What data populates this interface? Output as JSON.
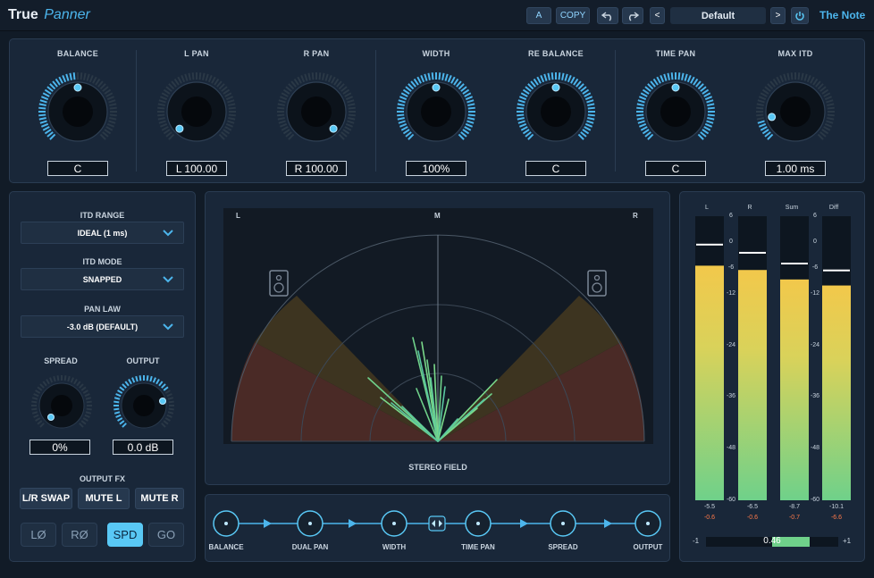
{
  "header": {
    "brand_name": "True",
    "brand_sub": "Panner",
    "a_label": "A",
    "copy_label": "COPY",
    "preset": "Default",
    "prev": "<",
    "next": ">",
    "company": "The Note"
  },
  "knobs": [
    {
      "label": "BALANCE",
      "value": "C"
    },
    {
      "label": "L PAN",
      "value": "L 100.00"
    },
    {
      "label": "R PAN",
      "value": "R 100.00"
    },
    {
      "label": "WIDTH",
      "value": "100%"
    },
    {
      "label": "RE BALANCE",
      "value": "C"
    },
    {
      "label": "TIME PAN",
      "value": "C"
    },
    {
      "label": "MAX ITD",
      "value": "1.00 ms"
    }
  ],
  "settings": {
    "itd_range": {
      "label": "ITD RANGE",
      "value": "IDEAL (1 ms)"
    },
    "itd_mode": {
      "label": "ITD MODE",
      "value": "SNAPPED"
    },
    "pan_law": {
      "label": "PAN LAW",
      "value": "-3.0 dB (DEFAULT)"
    },
    "spread": {
      "label": "SPREAD",
      "value": "0%"
    },
    "output": {
      "label": "OUTPUT",
      "value": "0.0 dB"
    },
    "output_fx": {
      "label": "OUTPUT FX",
      "buttons": [
        "L/R SWAP",
        "MUTE L",
        "MUTE R"
      ]
    },
    "modes": [
      "LØ",
      "RØ",
      "SPD",
      "GO"
    ],
    "active_mode": "SPD"
  },
  "stereo_field": {
    "left": "L",
    "mid": "M",
    "right": "R",
    "title": "STEREO FIELD"
  },
  "chain": {
    "stages": [
      "BALANCE",
      "DUAL PAN",
      "WIDTH",
      "TIME PAN",
      "SPREAD",
      "OUTPUT"
    ]
  },
  "meters": {
    "labels": [
      "L",
      "R",
      "Sum",
      "Diff"
    ],
    "scale": [
      "6",
      "0",
      "-6",
      "-12",
      "-24",
      "-36",
      "-48",
      "-60"
    ],
    "channels": [
      {
        "name": "L",
        "rms": "-5.5",
        "peak": "-0.6",
        "fill_top_db": -5.5,
        "peak_db": -0.6
      },
      {
        "name": "R",
        "rms": "-6.5",
        "peak": "-0.6",
        "fill_top_db": -6.5,
        "peak_db": -2.5
      },
      {
        "name": "Sum",
        "rms": "-8.7",
        "peak": "-0.7",
        "fill_top_db": -8.7,
        "peak_db": -5
      },
      {
        "name": "Diff",
        "rms": "-10.1",
        "peak": "-6.6",
        "fill_top_db": -10.1,
        "peak_db": -6.6
      }
    ],
    "correlation": {
      "min": "-1",
      "max": "+1",
      "value": "0.46"
    }
  },
  "colors": {
    "accent": "#4cb5ec",
    "active": "#59c8f5",
    "meter_top": "#f2c84b",
    "meter_bottom": "#6fd18a",
    "field_fill": "#4a2a26"
  }
}
